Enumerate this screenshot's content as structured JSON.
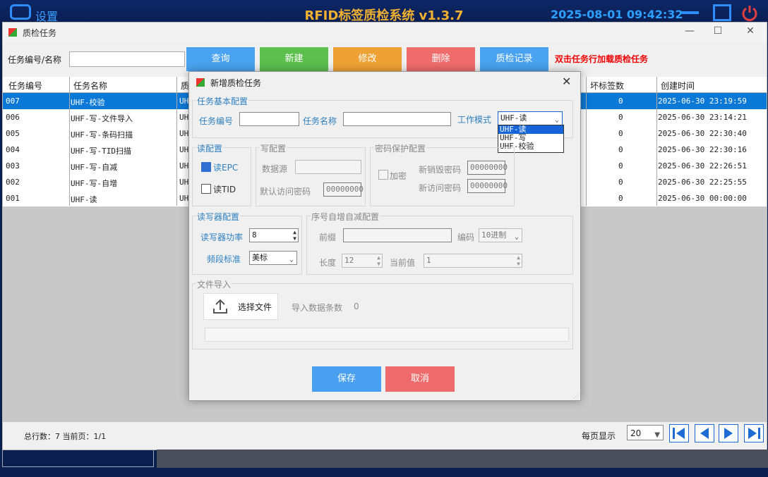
{
  "topbar": {
    "settings_label": "设置",
    "app_title": "RFID标签质检系统 v1.3.7",
    "datetime": "2025-08-01 09:42:32"
  },
  "window": {
    "title": "质检任务"
  },
  "toolbar": {
    "search_label": "任务编号/名称",
    "search_value": "",
    "buttons": [
      {
        "label": "查询",
        "color": "#4aa3f0"
      },
      {
        "label": "新建",
        "color": "#5cbf4e"
      },
      {
        "label": "修改",
        "color": "#efa233"
      },
      {
        "label": "删除",
        "color": "#ef6c6c"
      },
      {
        "label": "质检记录",
        "color": "#4aa3f0"
      }
    ],
    "hint": "双击任务行加载质检任务"
  },
  "table": {
    "columns": [
      "任务编号",
      "任务名称",
      "质",
      "坏标签数",
      "创建时间"
    ],
    "rows": [
      {
        "id": "007",
        "name": "UHF-校验",
        "col3": "UHF",
        "bad": "0",
        "created": "2025-06-30 23:19:59",
        "selected": true
      },
      {
        "id": "006",
        "name": "UHF-写-文件导入",
        "col3": "UHF",
        "bad": "0",
        "created": "2025-06-30 23:14:21",
        "selected": false
      },
      {
        "id": "005",
        "name": "UHF-写-条码扫描",
        "col3": "UHF",
        "bad": "0",
        "created": "2025-06-30 22:30:40",
        "selected": false
      },
      {
        "id": "004",
        "name": "UHF-写-TID扫描",
        "col3": "UHF",
        "bad": "0",
        "created": "2025-06-30 22:30:16",
        "selected": false
      },
      {
        "id": "003",
        "name": "UHF-写-自减",
        "col3": "UHF",
        "bad": "0",
        "created": "2025-06-30 22:26:51",
        "selected": false
      },
      {
        "id": "002",
        "name": "UHF-写-自增",
        "col3": "UHF",
        "bad": "0",
        "created": "2025-06-30 22:25:55",
        "selected": false
      },
      {
        "id": "001",
        "name": "UHF-读",
        "col3": "UHF",
        "bad": "0",
        "created": "2025-06-30 00:00:00",
        "selected": false
      }
    ]
  },
  "footer": {
    "total": "总行数：7 当前页：1/1",
    "per_page_label": "每页显示",
    "per_page_value": "20"
  },
  "dialog": {
    "title": "新增质检任务",
    "basic": {
      "group": "任务基本配置",
      "id_label": "任务编号",
      "id_value": "",
      "name_label": "任务名称",
      "name_value": "",
      "mode_label": "工作模式",
      "mode_value": "UHF-读",
      "mode_options": [
        "UHF-读",
        "UHF-写",
        "UHF-校验"
      ]
    },
    "read": {
      "group": "读配置",
      "epc": "读EPC",
      "tid": "读TID",
      "epc_checked": true,
      "tid_checked": false
    },
    "write": {
      "group": "写配置",
      "source_label": "数据源",
      "source_value": "",
      "pwd_label": "默认访问密码",
      "pwd_value": "00000000"
    },
    "password": {
      "group": "密码保护配置",
      "encrypt": "加密",
      "kill_label": "新销毁密码",
      "kill_value": "00000000",
      "access_label": "新访问密码",
      "access_value": "00000000"
    },
    "reader": {
      "group": "读写器配置",
      "power_label": "读写器功率",
      "power_value": "8",
      "band_label": "频段标准",
      "band_value": "美标"
    },
    "seq": {
      "group": "序号自增自减配置",
      "prefix_label": "前缀",
      "prefix_value": "",
      "encoding_label": "编码",
      "encoding_value": "10进制",
      "length_label": "长度",
      "length_value": "12",
      "current_label": "当前值",
      "current_value": "1"
    },
    "file": {
      "group": "文件导入",
      "choose_label": "选择文件",
      "count_label": "导入数据条数",
      "count_value": "0"
    },
    "ok_label": "保存",
    "cancel_label": "取消"
  }
}
